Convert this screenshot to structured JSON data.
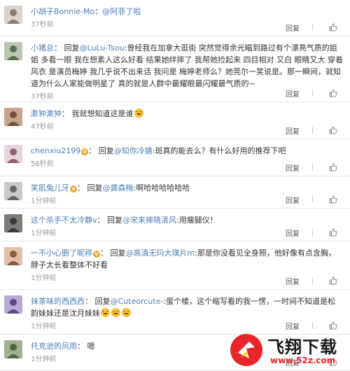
{
  "comments": [
    {
      "user": "小胡子Bonnie-Mo",
      "has_vip": false,
      "prefix": "：",
      "mentions_pre": "@阿菲了啦",
      "text": "",
      "time": "37秒前",
      "reply_label": "回复",
      "like_icon": "thumbs-up-icon"
    },
    {
      "user": "小猪总",
      "has_vip": false,
      "prefix": "： 回复",
      "mentions_pre": "@LuLu-Tsou",
      "text": ":曾经我在加拿大逛街 突然觉得余光瞄到路过有个漂亮气质的姐姐 多看一眼 我在想素人这么好看 结果她绊摔了 我帮她捡起来 四目相对 又白 眼睛又大 穿着风衣 是演员梅婷 我几乎说不出来话 我问是 梅婷老师么？她莞尔一笑说是。那一瞬间，就知道为什么人家能做明星了 真的就是人群中最耀眼最闪耀最气质的~",
      "time": "37秒前",
      "reply_label": "回复",
      "like_icon": "thumbs-up-icon"
    },
    {
      "user": "漱狆漱狆",
      "has_vip": false,
      "prefix": "： 我就想知道这是谁",
      "mentions_pre": "",
      "text": "",
      "emojis": [
        "laughing-emoji"
      ],
      "time": "47秒前",
      "reply_label": "回复",
      "like_icon": "thumbs-up-icon"
    },
    {
      "user": "chenxiu2199",
      "has_vip": true,
      "prefix": "： 回复",
      "mentions_pre": "@知你冷嬉",
      "text": ":斑真的能去么？有什么好用的推荐下吧",
      "time": "56秒前",
      "reply_label": "回复",
      "like_icon": "thumbs-up-icon"
    },
    {
      "user": "笑肌兔儿牙",
      "has_vip": true,
      "prefix": "： 回复",
      "mentions_pre": "@龚森梅",
      "text": ":啊哈哈哈哈哈哈",
      "time": "1分钟前",
      "reply_label": "回复",
      "like_icon": "thumbs-up-icon"
    },
    {
      "user": "这个杀手不太冷静v",
      "has_vip": false,
      "prefix": "： 回复",
      "mentions_pre": "@宋来捧晓清风",
      "text": ":用瘦腿仪！",
      "time": "1分钟前",
      "reply_label": "回复",
      "like_icon": "thumbs-up-icon"
    },
    {
      "user": "一不小心删了昵称",
      "has_vip": true,
      "prefix": "： 回复",
      "mentions_pre": "@高清无玛大璞片m",
      "text": ":那是你没看见全身照，他好像有点含胸，脖子太长看整体不好看",
      "time": "1分钟前",
      "reply_label": "回复",
      "like_icon": "thumbs-up-icon"
    },
    {
      "user": "抹茶味的西西西",
      "has_vip": false,
      "prefix": "： 回复",
      "mentions_pre": "@Cuteorcute-",
      "text": ":蛋个楼，这个缩写看的我一愣，一时间不知道是松韵妹妹还是沈月妹妹",
      "emojis": [
        "laughing-emoji",
        "laughing-emoji",
        "laughing-emoji"
      ],
      "time": "1分钟前",
      "reply_label": "回复",
      "like_icon": "thumbs-up-icon"
    },
    {
      "user": "托克逊的风雨",
      "has_vip": false,
      "prefix": "： 嗯",
      "mentions_pre": "",
      "text": "",
      "time": "1分钟前",
      "reply_label": "回复",
      "like_icon": "thumbs-up-icon"
    }
  ],
  "watermark": {
    "brand": "飞翔下载",
    "url": "www.52z.com"
  },
  "colors": {
    "link": "#4d7fb8",
    "time": "#999999",
    "border": "#e6e6e6",
    "vip_badge": "#f3a62b",
    "watermark_url": "#e8262a"
  }
}
